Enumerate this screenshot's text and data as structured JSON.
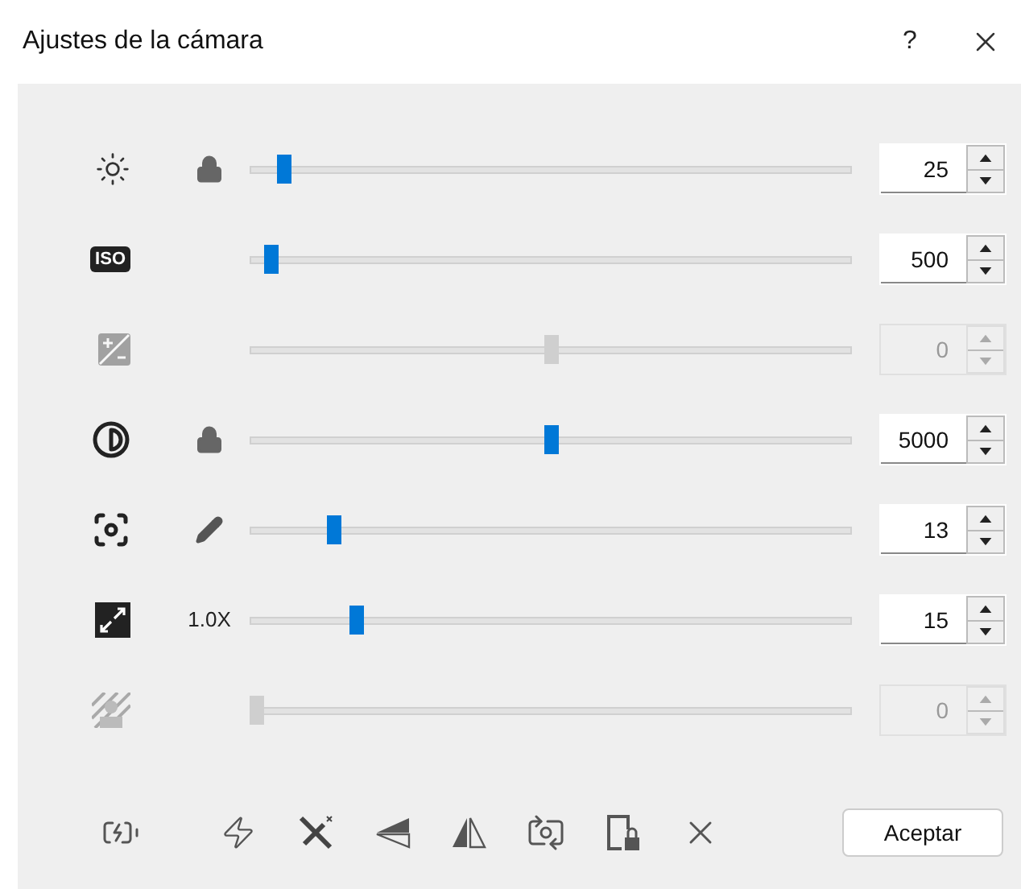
{
  "window": {
    "title": "Ajustes de la cámara",
    "help": "?"
  },
  "rows": [
    {
      "kind": "brightness",
      "accessory": {
        "kind": "lock"
      },
      "disabled": false,
      "level": 0.056,
      "value": "25"
    },
    {
      "kind": "iso",
      "icon_text": "ISO",
      "disabled": false,
      "level": 0.035,
      "value": "500"
    },
    {
      "kind": "exposure",
      "disabled": true,
      "level": 0.5,
      "value": "0"
    },
    {
      "kind": "contrast",
      "accessory": {
        "kind": "lock"
      },
      "disabled": false,
      "level": 0.5,
      "value": "5000"
    },
    {
      "kind": "focus",
      "accessory": {
        "kind": "pencil"
      },
      "disabled": false,
      "level": 0.14,
      "value": "13"
    },
    {
      "kind": "zoom",
      "accessory": {
        "kind": "text",
        "text": "1.0X"
      },
      "disabled": false,
      "level": 0.177,
      "value": "15"
    },
    {
      "kind": "backlight",
      "disabled": true,
      "level": 0.01,
      "value": "0"
    }
  ],
  "accept_button": "Aceptar"
}
